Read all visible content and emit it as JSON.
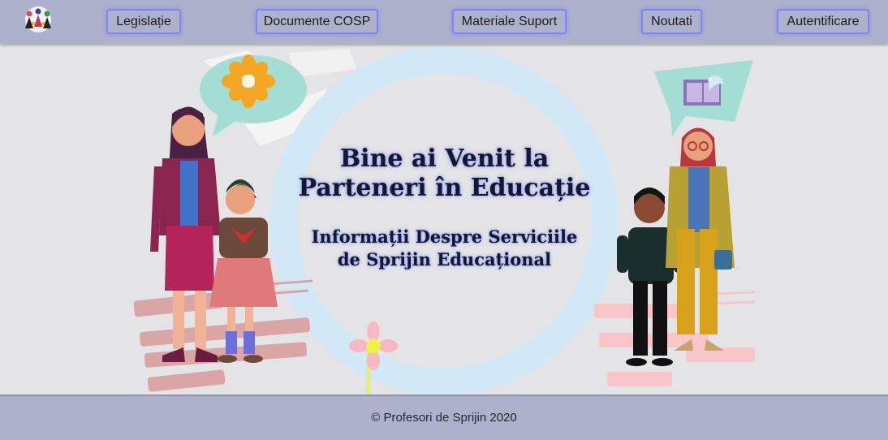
{
  "nav": {
    "items": [
      {
        "label": "Legislație"
      },
      {
        "label": "Documente COSP"
      },
      {
        "label": "Materiale Suport"
      },
      {
        "label": "Noutati"
      },
      {
        "label": "Autentificare"
      }
    ]
  },
  "hero": {
    "title": "Bine ai Venit la Parteneri în Educație",
    "subtitle": "Informații Despre Serviciile de Sprijin Educațional"
  },
  "footer": {
    "copyright": "© Profesori de Sprijin 2020"
  },
  "colors": {
    "navbar_bg": "#aeb1cb",
    "button_border": "#7f86f0",
    "hero_bg": "#e4e4e6",
    "circle": "#d3e8f6"
  }
}
